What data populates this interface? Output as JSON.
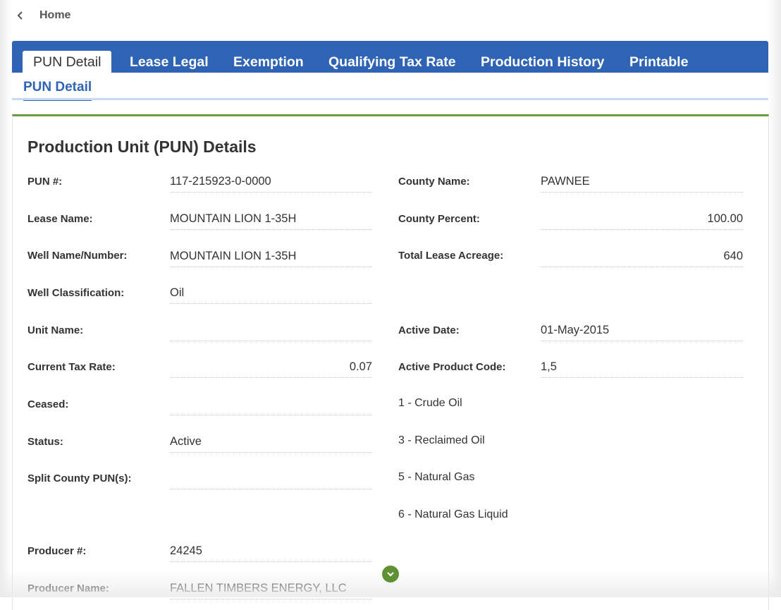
{
  "nav": {
    "back_label": "Home"
  },
  "tabs": [
    {
      "label": "PUN Detail"
    },
    {
      "label": "Lease Legal"
    },
    {
      "label": "Exemption"
    },
    {
      "label": "Qualifying Tax Rate"
    },
    {
      "label": "Production History"
    },
    {
      "label": "Printable"
    }
  ],
  "subtab": {
    "label": "PUN Detail"
  },
  "section": {
    "title": "Production Unit (PUN) Details",
    "left_fields": [
      {
        "label": "PUN #:",
        "value": "117-215923-0-0000"
      },
      {
        "label": "Lease Name:",
        "value": "MOUNTAIN LION 1-35H"
      },
      {
        "label": "Well Name/Number:",
        "value": "MOUNTAIN LION 1-35H"
      },
      {
        "label": "Well Classification:",
        "value": "Oil"
      },
      {
        "label": "Unit Name:",
        "value": ""
      },
      {
        "label": "Current Tax Rate:",
        "value": "0.07"
      },
      {
        "label": "Ceased:",
        "value": ""
      },
      {
        "label": "Status:",
        "value": "Active"
      },
      {
        "label": "Split County PUN(s):",
        "value": ""
      },
      {
        "label": "Producer #:",
        "value": "24245"
      },
      {
        "label": "Producer Name:",
        "value": "FALLEN TIMBERS ENERGY, LLC"
      }
    ],
    "right_fields": [
      {
        "label": "County Name:",
        "value": "PAWNEE"
      },
      {
        "label": "County Percent:",
        "value": "100.00"
      },
      {
        "label": "Total Lease Acreage:",
        "value": "640"
      },
      {
        "label": "Active Date:",
        "value": "01-May-2015"
      },
      {
        "label": "Active Product Code:",
        "value": "1,5"
      }
    ],
    "product_code_legend": [
      "1 - Crude Oil",
      "3 - Reclaimed Oil",
      "5 - Natural Gas",
      "6 - Natural Gas Liquid"
    ]
  },
  "colors": {
    "tab_bar": "#2e64b3",
    "section_accent": "#6d9a40",
    "scroll_button": "#5e9132"
  },
  "icons": {
    "back": "chevron-left-icon",
    "scroll": "chevron-down-icon"
  }
}
